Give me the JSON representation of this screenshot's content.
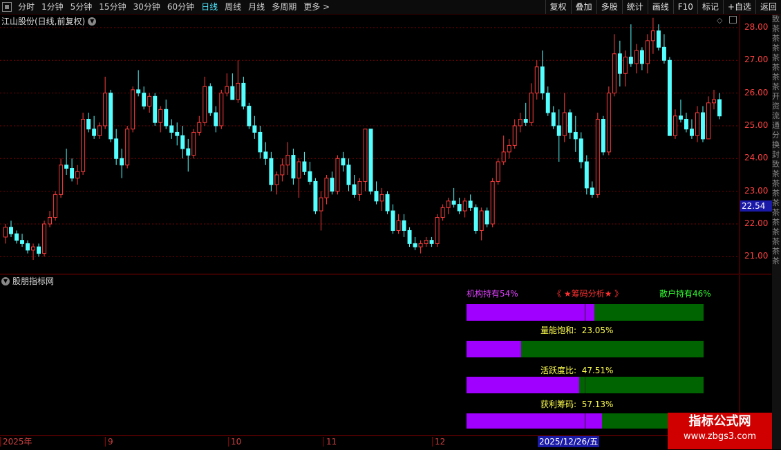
{
  "toolbar": {
    "periods": [
      "分时",
      "1分钟",
      "5分钟",
      "15分钟",
      "30分钟",
      "60分钟",
      "日线",
      "周线",
      "月线",
      "多周期",
      "更多 >"
    ],
    "active": "日线",
    "right_buttons": [
      "复权",
      "叠加",
      "多股",
      "统计",
      "画线",
      "F10",
      "标记",
      "+自选",
      "返回"
    ]
  },
  "chart": {
    "title": "江山股份(日线,前复权)",
    "price_axis": [
      "28.00",
      "27.00",
      "26.00",
      "25.00",
      "24.00",
      "23.00",
      "22.00",
      "21.00"
    ],
    "current_price": "22.54",
    "date_labels": [
      "2025年",
      "9",
      "10",
      "11",
      "12"
    ],
    "current_date": "2025/12/26/五",
    "colors": {
      "up": "#ff3c3c",
      "down": "#54ffff",
      "grid": "#7a0000",
      "price_box": "#1a1aa8"
    }
  },
  "chart_data": {
    "type": "candlestick",
    "ylim": [
      20.5,
      28.4
    ],
    "ohlc": [
      [
        21.6,
        22.0,
        21.4,
        21.9
      ],
      [
        21.9,
        22.1,
        21.6,
        21.7
      ],
      [
        21.7,
        21.8,
        21.4,
        21.5
      ],
      [
        21.5,
        21.7,
        21.3,
        21.4
      ],
      [
        21.4,
        21.5,
        21.1,
        21.2
      ],
      [
        21.2,
        21.4,
        20.9,
        21.3
      ],
      [
        21.3,
        21.4,
        21.0,
        21.1
      ],
      [
        21.1,
        22.1,
        21.0,
        22.0
      ],
      [
        22.0,
        22.4,
        21.9,
        22.2
      ],
      [
        22.2,
        23.0,
        22.1,
        22.9
      ],
      [
        22.9,
        24.0,
        22.8,
        23.8
      ],
      [
        23.8,
        24.3,
        23.5,
        23.7
      ],
      [
        23.7,
        24.0,
        23.3,
        23.4
      ],
      [
        23.4,
        23.8,
        23.2,
        23.6
      ],
      [
        23.6,
        25.4,
        23.5,
        25.2
      ],
      [
        25.2,
        25.4,
        24.8,
        24.9
      ],
      [
        24.9,
        25.3,
        24.6,
        24.7
      ],
      [
        24.7,
        25.1,
        24.6,
        25.0
      ],
      [
        25.0,
        26.5,
        24.9,
        26.0
      ],
      [
        26.0,
        26.1,
        24.5,
        24.6
      ],
      [
        24.6,
        24.9,
        23.8,
        24.0
      ],
      [
        24.0,
        24.3,
        23.4,
        23.8
      ],
      [
        23.8,
        25.0,
        23.7,
        24.9
      ],
      [
        24.9,
        26.2,
        24.8,
        26.1
      ],
      [
        26.1,
        26.7,
        25.9,
        26.0
      ],
      [
        26.0,
        26.2,
        25.5,
        25.6
      ],
      [
        25.6,
        26.0,
        25.4,
        25.9
      ],
      [
        25.9,
        26.0,
        25.0,
        25.1
      ],
      [
        25.1,
        25.6,
        24.8,
        25.5
      ],
      [
        25.5,
        25.8,
        24.9,
        25.0
      ],
      [
        25.0,
        25.2,
        24.6,
        24.8
      ],
      [
        24.8,
        25.1,
        24.4,
        24.7
      ],
      [
        24.7,
        25.0,
        24.0,
        24.3
      ],
      [
        24.3,
        24.6,
        23.6,
        24.1
      ],
      [
        24.1,
        24.9,
        24.0,
        24.8
      ],
      [
        24.8,
        25.3,
        24.7,
        25.1
      ],
      [
        25.1,
        26.5,
        25.0,
        26.2
      ],
      [
        26.2,
        26.3,
        25.3,
        25.4
      ],
      [
        25.4,
        25.6,
        24.8,
        25.0
      ],
      [
        25.0,
        26.1,
        24.9,
        26.0
      ],
      [
        26.0,
        26.6,
        25.9,
        26.2
      ],
      [
        26.2,
        26.6,
        25.8,
        25.8
      ],
      [
        25.8,
        27.0,
        25.7,
        26.3
      ],
      [
        26.3,
        26.5,
        25.5,
        25.6
      ],
      [
        25.6,
        25.7,
        24.9,
        25.0
      ],
      [
        25.0,
        25.3,
        24.6,
        24.8
      ],
      [
        24.8,
        25.0,
        24.0,
        24.2
      ],
      [
        24.2,
        24.5,
        23.8,
        24.0
      ],
      [
        24.0,
        24.2,
        23.0,
        23.2
      ],
      [
        23.2,
        23.6,
        22.9,
        23.5
      ],
      [
        23.5,
        24.0,
        23.3,
        23.8
      ],
      [
        23.8,
        24.5,
        23.5,
        24.1
      ],
      [
        24.1,
        24.3,
        23.2,
        23.4
      ],
      [
        23.4,
        24.0,
        22.8,
        23.9
      ],
      [
        23.9,
        24.2,
        23.5,
        23.6
      ],
      [
        23.6,
        23.9,
        23.2,
        23.3
      ],
      [
        23.3,
        23.4,
        22.3,
        22.4
      ],
      [
        22.4,
        23.0,
        21.8,
        22.8
      ],
      [
        22.8,
        23.5,
        22.6,
        23.4
      ],
      [
        23.4,
        23.6,
        22.9,
        23.0
      ],
      [
        23.0,
        24.1,
        22.9,
        24.0
      ],
      [
        24.0,
        24.2,
        23.6,
        23.8
      ],
      [
        23.8,
        24.0,
        23.0,
        23.2
      ],
      [
        23.2,
        23.5,
        22.8,
        22.9
      ],
      [
        22.9,
        23.4,
        22.7,
        23.3
      ],
      [
        23.3,
        24.9,
        23.0,
        24.9
      ],
      [
        24.9,
        23.2,
        22.9,
        23.0
      ],
      [
        23.0,
        23.3,
        22.6,
        22.7
      ],
      [
        22.7,
        23.1,
        22.4,
        22.9
      ],
      [
        22.9,
        23.0,
        22.3,
        22.4
      ],
      [
        22.4,
        22.6,
        21.7,
        21.8
      ],
      [
        21.8,
        22.3,
        21.7,
        22.1
      ],
      [
        22.1,
        22.3,
        21.6,
        21.8
      ],
      [
        21.8,
        21.9,
        21.3,
        21.4
      ],
      [
        21.4,
        21.6,
        21.2,
        21.3
      ],
      [
        21.3,
        21.5,
        21.1,
        21.4
      ],
      [
        21.4,
        21.6,
        21.3,
        21.5
      ],
      [
        21.5,
        21.6,
        21.3,
        21.4
      ],
      [
        21.4,
        22.3,
        21.3,
        22.2
      ],
      [
        22.2,
        22.6,
        22.1,
        22.5
      ],
      [
        22.5,
        22.8,
        22.3,
        22.7
      ],
      [
        22.7,
        23.1,
        22.5,
        22.6
      ],
      [
        22.6,
        22.8,
        22.3,
        22.4
      ],
      [
        22.4,
        22.8,
        22.2,
        22.7
      ],
      [
        22.7,
        22.9,
        22.4,
        22.5
      ],
      [
        22.5,
        22.6,
        21.7,
        21.8
      ],
      [
        21.8,
        22.5,
        21.5,
        22.4
      ],
      [
        22.4,
        22.5,
        21.9,
        22.0
      ],
      [
        22.0,
        23.4,
        21.9,
        23.3
      ],
      [
        23.3,
        24.0,
        23.2,
        23.9
      ],
      [
        23.9,
        24.7,
        23.8,
        24.2
      ],
      [
        24.2,
        24.6,
        24.0,
        24.4
      ],
      [
        24.4,
        25.2,
        24.3,
        25.0
      ],
      [
        25.0,
        25.4,
        24.8,
        25.2
      ],
      [
        25.2,
        25.7,
        25.0,
        25.1
      ],
      [
        25.1,
        26.3,
        25.0,
        26.0
      ],
      [
        26.0,
        27.0,
        25.8,
        26.8
      ],
      [
        26.8,
        27.3,
        25.8,
        26.0
      ],
      [
        26.0,
        26.2,
        25.3,
        25.4
      ],
      [
        25.4,
        25.6,
        24.9,
        25.0
      ],
      [
        25.0,
        25.5,
        23.9,
        24.7
      ],
      [
        24.7,
        26.0,
        24.5,
        25.4
      ],
      [
        25.4,
        25.5,
        24.6,
        24.8
      ],
      [
        24.8,
        25.3,
        24.2,
        24.6
      ],
      [
        24.6,
        24.8,
        23.7,
        23.9
      ],
      [
        23.9,
        24.1,
        22.9,
        23.1
      ],
      [
        23.1,
        23.3,
        22.8,
        22.9
      ],
      [
        22.9,
        25.4,
        22.8,
        25.2
      ],
      [
        25.2,
        25.3,
        24.1,
        24.2
      ],
      [
        24.2,
        26.2,
        24.1,
        26.0
      ],
      [
        26.0,
        27.8,
        25.9,
        27.2
      ],
      [
        27.2,
        27.6,
        26.2,
        26.6
      ],
      [
        26.6,
        27.3,
        26.2,
        27.1
      ],
      [
        27.1,
        28.1,
        26.8,
        26.9
      ],
      [
        26.9,
        27.5,
        26.6,
        27.3
      ],
      [
        27.3,
        27.4,
        26.7,
        26.9
      ],
      [
        26.9,
        27.8,
        26.6,
        27.6
      ],
      [
        27.6,
        28.3,
        27.2,
        27.9
      ],
      [
        27.9,
        28.1,
        27.3,
        27.4
      ],
      [
        27.4,
        27.8,
        26.9,
        27.0
      ],
      [
        27.0,
        27.1,
        24.7,
        24.7
      ],
      [
        24.7,
        25.5,
        24.6,
        25.3
      ],
      [
        25.3,
        25.8,
        25.1,
        25.2
      ],
      [
        25.2,
        25.4,
        24.8,
        24.9
      ],
      [
        24.9,
        25.2,
        24.6,
        24.7
      ],
      [
        24.7,
        25.6,
        24.5,
        25.4
      ],
      [
        25.4,
        25.6,
        24.5,
        24.6
      ],
      [
        24.6,
        25.9,
        24.6,
        25.7
      ],
      [
        25.7,
        26.1,
        25.5,
        25.8
      ],
      [
        25.8,
        26.0,
        25.2,
        25.3
      ]
    ]
  },
  "indicator": {
    "title": "股朋指标网",
    "header_left": "机构持有54%",
    "header_center": "《 ★筹码分析★ 》",
    "header_right": "散户持有46%",
    "rows": [
      {
        "label": "",
        "value": "",
        "fill_pct": 54
      },
      {
        "label": "量能饱和:",
        "value": "23.05%",
        "fill_pct": 23.05
      },
      {
        "label": "活跃度比:",
        "value": "47.51%",
        "fill_pct": 47.51
      },
      {
        "label": "获利筹码:",
        "value": "57.13%",
        "fill_pct": 57.13
      }
    ]
  },
  "watermark": {
    "line1": "指标公式网",
    "line2": "www.zbgs3.com"
  },
  "side_strip": "致茶茶茶茶茶茶茶开资流通分换封致茶茶茶茶茶茶茶茶茶茶"
}
